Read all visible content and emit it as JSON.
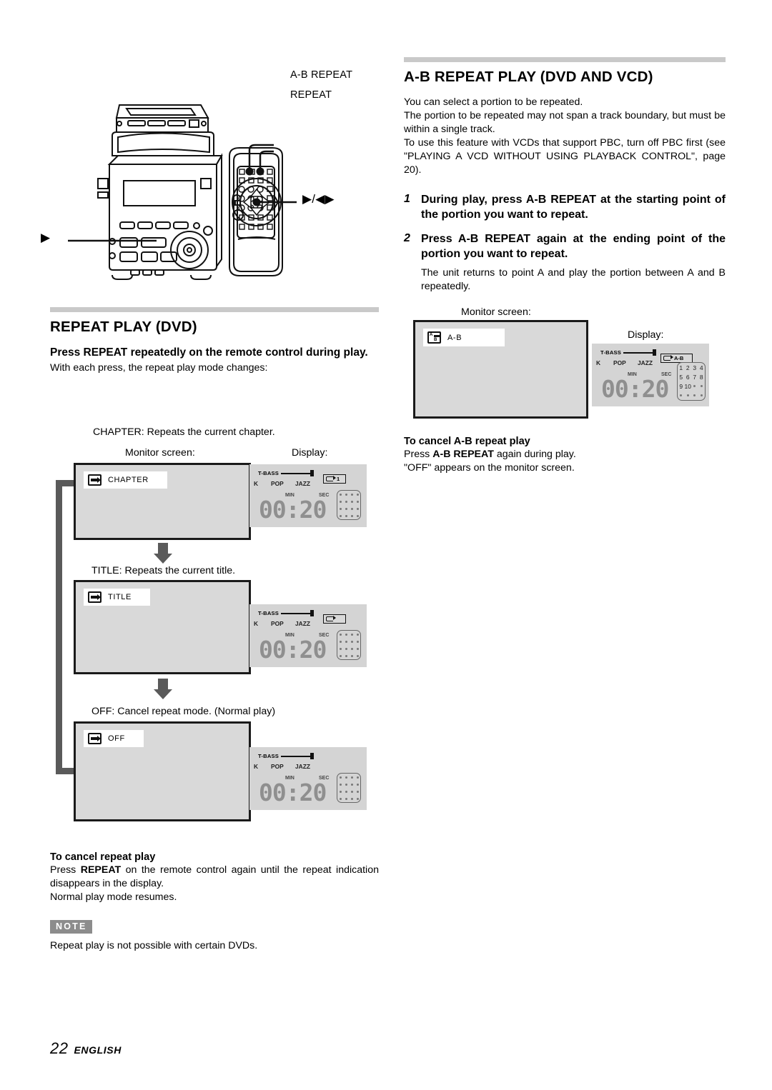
{
  "document": {
    "page_number": "22",
    "language": "ENGLISH"
  },
  "illustration": {
    "callouts": [
      {
        "label": "A-B REPEAT"
      },
      {
        "label": "REPEAT"
      },
      {
        "label": "▶/◀▶"
      },
      {
        "label": "▶"
      }
    ]
  },
  "left_section": {
    "title": "REPEAT PLAY (DVD)",
    "lead": "Press REPEAT repeatedly on the remote control during play.",
    "intro": "With each press, the repeat play mode changes:",
    "steps": [
      {
        "caption": "CHAPTER: Repeats the current chapter.",
        "monitor_caption": "Monitor screen:",
        "osd_label": "CHAPTER",
        "osd_icon": "repeat-loop-icon",
        "display_caption": "Display:",
        "display": {
          "tbass": "T-BASS",
          "eq": [
            "K",
            "POP",
            "JAZZ"
          ],
          "min_label": "MIN",
          "sec_label": "SEC",
          "time": "00:20",
          "repeat_indicator": "1",
          "show_repeat": true,
          "track_grid": []
        }
      },
      {
        "caption": "TITLE: Repeats the current title.",
        "monitor_caption": "",
        "osd_label": "TITLE",
        "osd_icon": "repeat-loop-icon",
        "display_caption": "",
        "display": {
          "tbass": "T-BASS",
          "eq": [
            "K",
            "POP",
            "JAZZ"
          ],
          "min_label": "MIN",
          "sec_label": "SEC",
          "time": "00:20",
          "repeat_indicator": "",
          "show_repeat": true,
          "track_grid": []
        }
      },
      {
        "caption": "OFF: Cancel repeat mode. (Normal play)",
        "monitor_caption": "",
        "osd_label": "OFF",
        "osd_icon": "repeat-loop-icon",
        "display_caption": "",
        "display": {
          "tbass": "T-BASS",
          "eq": [
            "K",
            "POP",
            "JAZZ"
          ],
          "min_label": "MIN",
          "sec_label": "SEC",
          "time": "00:20",
          "repeat_indicator": "",
          "show_repeat": false,
          "track_grid": []
        }
      }
    ],
    "cancel": {
      "heading": "To cancel repeat play",
      "line1_pre": "Press ",
      "line1_bold": "REPEAT",
      "line1_post": " on the remote control again until the repeat indication disappears in the display.",
      "line2": "Normal play mode resumes."
    },
    "note": {
      "badge": "NOTE",
      "text": "Repeat play is not possible with certain DVDs."
    }
  },
  "right_section": {
    "title": "A-B REPEAT PLAY (DVD AND VCD)",
    "paragraphs": [
      "You can select a portion to be repeated.",
      "The portion to be repeated may not span a track boundary, but must be within a single track.",
      "To use this feature with VCDs that support PBC, turn off PBC first (see \"PLAYING A VCD WITHOUT USING PLAYBACK CONTROL\", page 20)."
    ],
    "steps": [
      {
        "num": "1",
        "text": "During play, press A-B REPEAT at the starting point of the portion you want to repeat.",
        "sub": ""
      },
      {
        "num": "2",
        "text": "Press A-B REPEAT again at the ending point of the portion you want to repeat.",
        "sub": "The unit returns to point A and play the portion between A and B repeatedly."
      }
    ],
    "monitor_caption": "Monitor screen:",
    "osd_label": "A-B",
    "osd_icon": "ab-repeat-icon",
    "display_caption": "Display:",
    "display": {
      "tbass": "T-BASS",
      "eq": [
        "K",
        "POP",
        "JAZZ"
      ],
      "min_label": "MIN",
      "sec_label": "SEC",
      "time": "00:20",
      "repeat_indicator": "A-B",
      "show_repeat": true,
      "track_grid": [
        "1",
        "2",
        "3",
        "4",
        "5",
        "6",
        "7",
        "8",
        "9",
        "10"
      ]
    },
    "cancel": {
      "heading": "To cancel A-B repeat play",
      "line1_pre": "Press ",
      "line1_bold": "A-B REPEAT",
      "line1_post": " again during play.",
      "line2": "\"OFF\" appears on the monitor screen."
    }
  },
  "colors": {
    "rule": "#c9c9c9",
    "arrow": "#5a5a5a",
    "screen_bg": "#d9d9d9",
    "display_bg": "#d4d4d4",
    "note_badge": "#8c8c8c"
  }
}
